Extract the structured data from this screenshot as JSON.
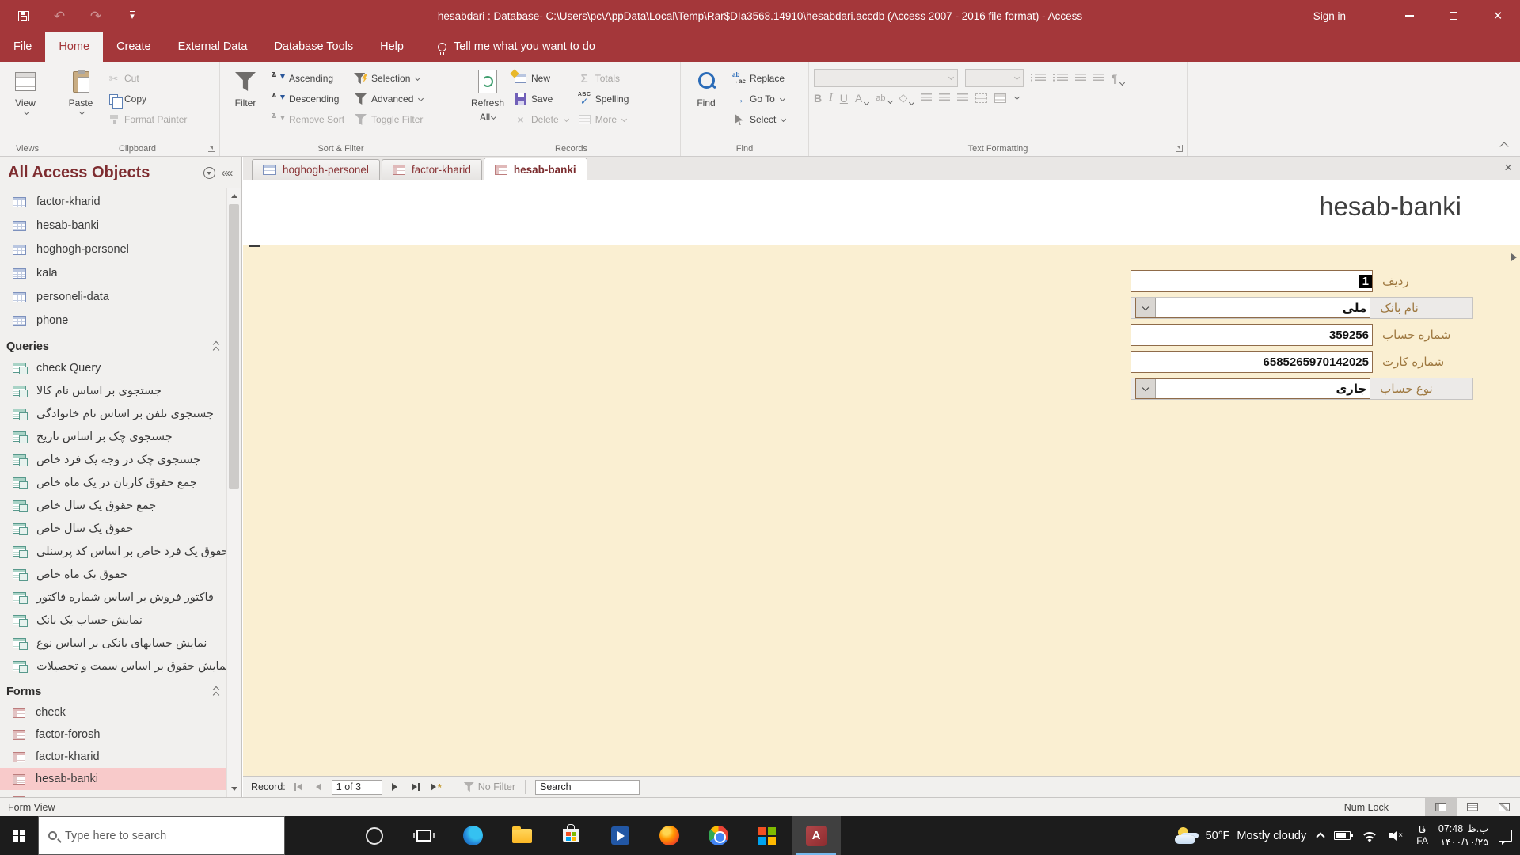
{
  "colors": {
    "accent": "#A4373A",
    "form_body": "#FAEFD2",
    "field_border": "#8F6B49",
    "field_label": "#9E7840",
    "selected_nav_row": "#F8CACA",
    "taskbar": "#1C1C1C"
  },
  "titlebar": {
    "title": "hesabdari : Database- C:\\Users\\pc\\AppData\\Local\\Temp\\Rar$DIa3568.14910\\hesabdari.accdb (Access 2007 - 2016 file format)  -  Access",
    "sign_in": "Sign in"
  },
  "menubar": {
    "tabs": [
      "File",
      "Home",
      "Create",
      "External Data",
      "Database Tools",
      "Help"
    ],
    "active_tab": "Home",
    "tell_me": "Tell me what you want to do"
  },
  "ribbon": {
    "views": {
      "view": "View",
      "group": "Views"
    },
    "clipboard": {
      "paste": "Paste",
      "cut": "Cut",
      "copy": "Copy",
      "format_painter": "Format Painter",
      "group": "Clipboard"
    },
    "sort_filter": {
      "filter": "Filter",
      "ascending": "Ascending",
      "descending": "Descending",
      "remove_sort": "Remove Sort",
      "selection": "Selection",
      "advanced": "Advanced",
      "toggle_filter": "Toggle Filter",
      "group": "Sort & Filter"
    },
    "records": {
      "refresh_line1": "Refresh",
      "refresh_line2": "All",
      "new": "New",
      "save": "Save",
      "delete": "Delete",
      "totals": "Totals",
      "spelling": "Spelling",
      "more": "More",
      "group": "Records"
    },
    "find": {
      "find": "Find",
      "replace": "Replace",
      "go_to": "Go To",
      "select": "Select",
      "group": "Find"
    },
    "text_formatting": {
      "bold": "B",
      "italic": "I",
      "underline": "U",
      "group": "Text Formatting"
    }
  },
  "doc_tabs": [
    {
      "label": "hoghogh-personel",
      "type": "table"
    },
    {
      "label": "factor-kharid",
      "type": "form"
    },
    {
      "label": "hesab-banki",
      "type": "form",
      "active": true
    }
  ],
  "nav": {
    "title": "All Access Objects",
    "tables": [
      "factor-kharid",
      "hesab-banki",
      "hoghogh-personel",
      "kala",
      "personeli-data",
      "phone"
    ],
    "queries_header": "Queries",
    "queries": [
      "check Query",
      "جستجوی بر اساس نام کالا",
      "جستجوی تلفن بر اساس نام خانوادگی",
      "جستجوی چک بر اساس تاریخ",
      "جستجوی چک در وجه یک فرد خاص",
      "جمع حقوق کارنان در یک ماه خاص",
      "جمع حقوق یک سال خاص",
      "حقوق یک سال خاص",
      "حقوق یک فرد خاص بر اساس کد پرسنلی",
      "حقوق یک ماه خاص",
      "فاکتور فروش بر اساس شماره فاکتور",
      "نمایش حساب یک بانک",
      "نمایش حسابهای بانکی بر اساس نوع",
      "نمایش حقوق بر اساس سمت و تحصیلات"
    ],
    "forms_header": "Forms",
    "forms": [
      {
        "label": "check"
      },
      {
        "label": "factor-forosh"
      },
      {
        "label": "factor-kharid"
      },
      {
        "label": "hesab-banki",
        "selected": true
      }
    ]
  },
  "form": {
    "title": "hesab-banki",
    "fields": [
      {
        "label": "ردیف",
        "value": "1",
        "selected": true
      },
      {
        "label": "نام بانک",
        "value": "ملی",
        "combo": true
      },
      {
        "label": "شماره حساب",
        "value": "359256"
      },
      {
        "label": "شماره کارت",
        "value": "6585265970142025"
      },
      {
        "label": "نوع حساب",
        "value": "جاری",
        "combo": true
      }
    ]
  },
  "record_nav": {
    "label": "Record:",
    "position": "1 of 3",
    "no_filter": "No Filter",
    "search": "Search"
  },
  "status": {
    "left": "Form View",
    "num_lock": "Num Lock"
  },
  "taskbar": {
    "search_placeholder": "Type here to search",
    "weather_temp": "50°F",
    "weather_condition": "Mostly cloudy",
    "lang_top": "فا",
    "lang_bottom": "FA",
    "time": "07:48",
    "time_suffix": "ب.ظ",
    "date": "۱۴۰۰/۱۰/۲۵"
  }
}
